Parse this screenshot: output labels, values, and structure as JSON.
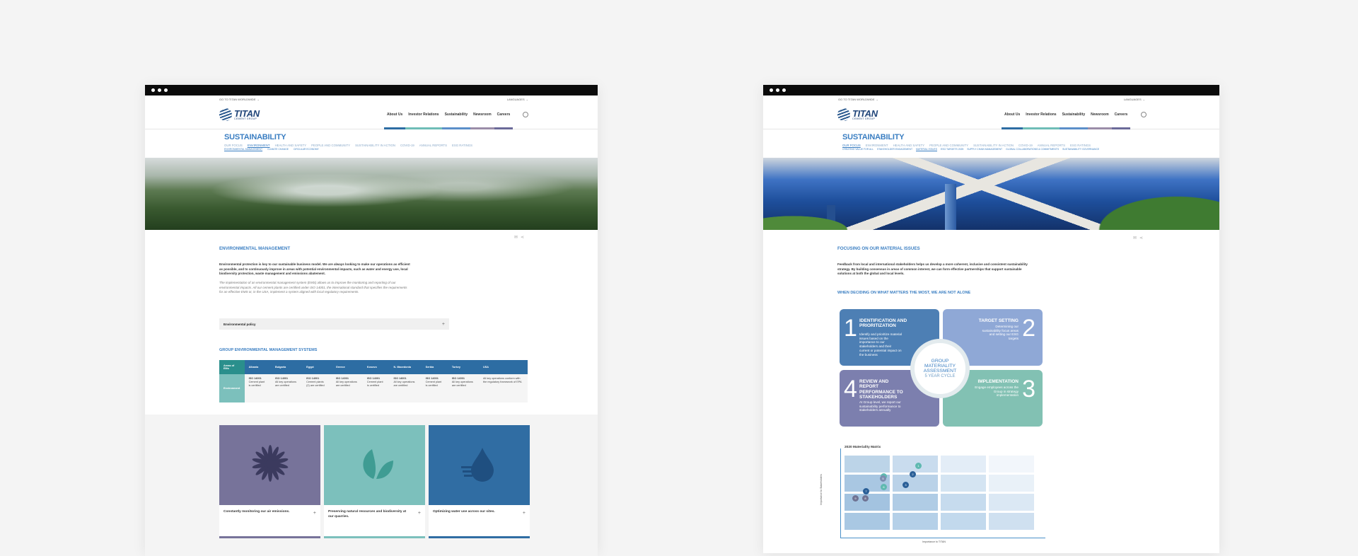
{
  "left": {
    "utility": {
      "worldwide": "GO TO TITAN WORLDWIDE",
      "languages": "LANGUAGES"
    },
    "logo": {
      "word": "TITAN",
      "sub": "CEMENT GROUP"
    },
    "nav": [
      {
        "label": "About Us",
        "color": "#2d6da3"
      },
      {
        "label": "Investor Relations",
        "color": "#6fbdb7"
      },
      {
        "label": "Sustainability",
        "color": "#5b8fc9"
      },
      {
        "label": "Newsroom",
        "color": "#9a8da8"
      },
      {
        "label": "Careers",
        "color": "#6b6a99"
      }
    ],
    "section_title": "SUSTAINABILITY",
    "subnav": [
      "OUR FOCUS",
      "ENVIRONMENT",
      "HEALTH AND SAFETY",
      "PEOPLE AND COMMUNITY",
      "SUSTAINABILITY IN ACTION",
      "COVID-19",
      "ANNUAL REPORTS",
      "ESG RATINGS"
    ],
    "subnav2": [
      "ENVIRONMENTAL MANAGEMENT",
      "CLIMATE CHANGE",
      "CIRCULAR ECONOMY"
    ],
    "heading": "ENVIRONMENTAL MANAGEMENT",
    "lead": "Environmental protection is key to our sustainable business model. We are always looking to make our operations as efficient as possible, and to continuously improve in areas with potential environmental impacts, such as water and energy use, local biodiversity protection, waste management and emissions abatement.",
    "body": "The implementation of an environmental management system (EMS) allows us to improve the monitoring and reporting of our environmental impacts. All our cement plants are certified under ISO 14001, the international standard that specifies the requirements for an effective EMS or, in the USA, implement a system aligned with local regulatory requirements.",
    "accordion": "Environmental policy",
    "ems_title": "GROUP ENVIRONMENTAL MANAGEMENT SYSTEMS",
    "ems_headers": [
      "Areas of EMs",
      "Albania",
      "Bulgaria",
      "Egypt",
      "Greece",
      "Kosovo",
      "N. Macedonia",
      "Serbia",
      "Turkey",
      "USA"
    ],
    "ems_row_label": "Environment",
    "ems_cells": [
      "ISO 14001\nCement plant is certified",
      "ISO 14001\nAll key operations are certified",
      "ISO 14001\nCement plants (2) are certified",
      "ISO 14001\nAll key operations are certified",
      "ISO 14001\nCement plant is certified",
      "ISO 14001\nAll key operations are certified",
      "ISO 14001\nCement plant is certified",
      "ISO 14001\nAll key operations are certified",
      "All key operations conform with the regulatory framework of EPA"
    ],
    "cards": [
      {
        "caption": "Constantly monitoring our air emissions.",
        "color": "#77739a",
        "icon": "flower-icon"
      },
      {
        "caption": "Preserving natural resources and biodiversity at our quarries.",
        "color": "#7cc0bc",
        "icon": "leaf-icon"
      },
      {
        "caption": "Optimizing water use across our sites.",
        "color": "#306da3",
        "icon": "water-drop-icon"
      }
    ]
  },
  "right": {
    "utility": {
      "worldwide": "GO TO TITAN WORLDWIDE",
      "languages": "LANGUAGES"
    },
    "logo": {
      "word": "TITAN",
      "sub": "CEMENT GROUP"
    },
    "nav": [
      {
        "label": "About Us",
        "color": "#2d6da3"
      },
      {
        "label": "Investor Relations",
        "color": "#6fbdb7"
      },
      {
        "label": "Sustainability",
        "color": "#5b8fc9"
      },
      {
        "label": "Newsroom",
        "color": "#9a8da8"
      },
      {
        "label": "Careers",
        "color": "#6b6a99"
      }
    ],
    "section_title": "SUSTAINABILITY",
    "subnav": [
      "OUR FOCUS",
      "ENVIRONMENT",
      "HEALTH AND SAFETY",
      "PEOPLE AND COMMUNITY",
      "SUSTAINABILITY IN ACTION",
      "COVID-19",
      "ANNUAL REPORTS",
      "ESG RATINGS"
    ],
    "subnav2": [
      "CREATING VALUE FOR ALL",
      "STAKEHOLDER ENGAGEMENT",
      "MATERIAL ISSUES",
      "ESG TARGETS 2025",
      "SUPPLY CHAIN MANAGEMENT",
      "GLOBAL COLLABORATIONS & COMMITMENTS",
      "SUSTAINABILITY GOVERNANCE"
    ],
    "heading": "FOCUSING ON OUR MATERIAL ISSUES",
    "lead": "Feedback from local and international stakeholders helps us develop a more coherent, inclusive and consistent sustainability strategy. By building consensus in areas of common interest, we can form effective partnerships that support sustainable solutions at both the global and local levels.",
    "subheading": "WHEN DECIDING ON WHAT MATTERS THE MOST, WE ARE NOT ALONE",
    "cycle": {
      "center": [
        "GROUP",
        "MATERIALITY",
        "ASSESSMENT"
      ],
      "center_sub": "5 YEAR CYCLE",
      "quadrants": [
        {
          "num": "1",
          "title": "IDENTIFICATION AND PRIORITIZATION",
          "desc": "Identify and prioritize material issues based on the importance to our stakeholders and their current or potential impact on the business",
          "color": "#4d7fb4"
        },
        {
          "num": "2",
          "title": "TARGET SETTING",
          "desc": "Determining our sustainability focus areas and setting our ESG targets",
          "color": "#8fa8d6"
        },
        {
          "num": "3",
          "title": "IMPLEMENTATION",
          "desc": "Engage employees across the Group in strategy implementation",
          "color": "#82c1b3"
        },
        {
          "num": "4",
          "title": "REVIEW AND REPORT PERFORMANCE TO STAKEHOLDERS",
          "desc": "At Group level, we report our sustainability performance to stakeholders annually",
          "color": "#7c7fae"
        }
      ]
    },
    "matrix_title": "2020 Materiality Matrix",
    "matrix_ylabel": "Importance to Stakeholders",
    "matrix_xlabel": "Importance to TITAN",
    "matrix_points": [
      {
        "label": "1",
        "color": "#5fb9b0"
      },
      {
        "label": "2",
        "color": "#2a5f97"
      },
      {
        "label": "3",
        "color": "#2a5f97"
      },
      {
        "label": "4",
        "color": "#5fb9b0"
      },
      {
        "label": "5",
        "color": "#7c8db0"
      },
      {
        "label": "6",
        "color": "#5fb9b0"
      },
      {
        "label": "7",
        "color": "#2a5f97"
      },
      {
        "label": "8",
        "color": "#6f7393"
      },
      {
        "label": "9",
        "color": "#6f7393"
      }
    ]
  }
}
